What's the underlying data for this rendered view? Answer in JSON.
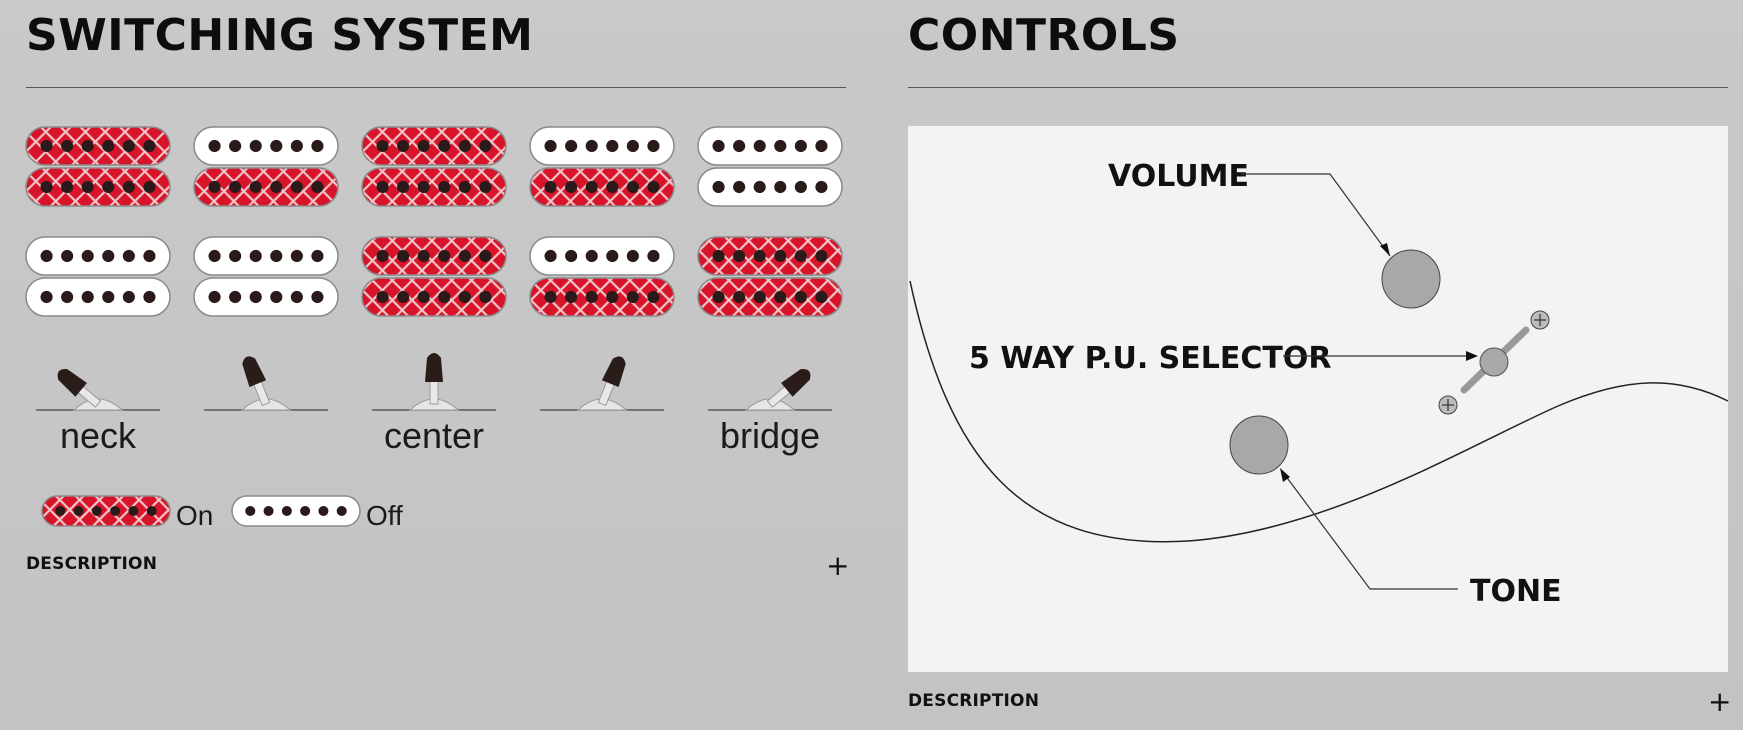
{
  "switching": {
    "title": "SWITCHING SYSTEM",
    "positions": [
      {
        "label": "neck",
        "pickups": [
          [
            "on",
            "on"
          ],
          [
            "off",
            "off"
          ]
        ]
      },
      {
        "label": "",
        "pickups": [
          [
            "off",
            "on"
          ],
          [
            "off",
            "off"
          ]
        ]
      },
      {
        "label": "center",
        "pickups": [
          [
            "on",
            "on"
          ],
          [
            "on",
            "on"
          ]
        ]
      },
      {
        "label": "",
        "pickups": [
          [
            "off",
            "on"
          ],
          [
            "off",
            "on"
          ]
        ]
      },
      {
        "label": "bridge",
        "pickups": [
          [
            "off",
            "off"
          ],
          [
            "on",
            "on"
          ]
        ]
      }
    ],
    "legend": {
      "on": "On",
      "off": "Off"
    },
    "description_label": "DESCRIPTION",
    "plus": "+"
  },
  "controls": {
    "title": "CONTROLS",
    "labels": {
      "volume": "VOLUME",
      "selector": "5 WAY P.U. SELECTOR",
      "tone": "TONE"
    },
    "description_label": "DESCRIPTION",
    "plus": "+"
  },
  "colors": {
    "pickup_on": "#d8142a",
    "pickup_off": "#ffffff",
    "knob": "#a8a8a8",
    "diagram_bg": "#f3f3f3"
  }
}
